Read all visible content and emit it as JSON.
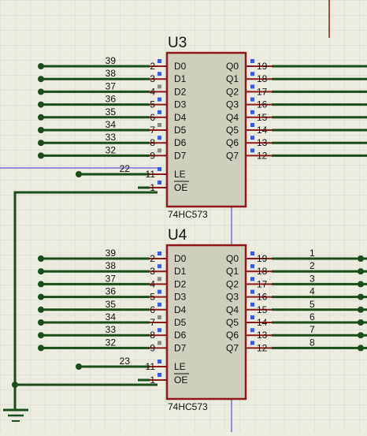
{
  "colors": {
    "background": "#ebebe0",
    "grid": "#d6d6cc",
    "wire": "#1b4d1b",
    "pin": "#8b1a1a",
    "chip_fill": "#cfcfbe",
    "marker_blue": "#3b5bdb",
    "marker_gray": "#8a8a8a",
    "bus_line": "#3a3acc"
  },
  "chips": [
    {
      "ref": "U3",
      "part": "74HC573",
      "inputs": [
        {
          "name": "D0",
          "pin": "2",
          "net": "39",
          "marker": "blue"
        },
        {
          "name": "D1",
          "pin": "3",
          "net": "38",
          "marker": "blue"
        },
        {
          "name": "D2",
          "pin": "4",
          "net": "37",
          "marker": "gray"
        },
        {
          "name": "D3",
          "pin": "5",
          "net": "36",
          "marker": "blue"
        },
        {
          "name": "D4",
          "pin": "6",
          "net": "35",
          "marker": "blue"
        },
        {
          "name": "D5",
          "pin": "7",
          "net": "34",
          "marker": "gray"
        },
        {
          "name": "D6",
          "pin": "8",
          "net": "33",
          "marker": "blue"
        },
        {
          "name": "D7",
          "pin": "9",
          "net": "32",
          "marker": "gray"
        }
      ],
      "outputs": [
        {
          "name": "Q0",
          "pin": "19",
          "net": "",
          "marker": "blue"
        },
        {
          "name": "Q1",
          "pin": "18",
          "net": "",
          "marker": "blue"
        },
        {
          "name": "Q2",
          "pin": "17",
          "net": "",
          "marker": "blue"
        },
        {
          "name": "Q3",
          "pin": "16",
          "net": "",
          "marker": "blue"
        },
        {
          "name": "Q4",
          "pin": "15",
          "net": "",
          "marker": "blue"
        },
        {
          "name": "Q5",
          "pin": "14",
          "net": "",
          "marker": "blue"
        },
        {
          "name": "Q6",
          "pin": "13",
          "net": "",
          "marker": "blue"
        },
        {
          "name": "Q7",
          "pin": "12",
          "net": "",
          "marker": "blue"
        }
      ],
      "controls": [
        {
          "name": "LE",
          "pin": "11",
          "net": "22",
          "overline": false,
          "marker": "blue"
        },
        {
          "name": "OE",
          "pin": "1",
          "net": "",
          "overline": true,
          "marker": "blue"
        }
      ]
    },
    {
      "ref": "U4",
      "part": "74HC573",
      "inputs": [
        {
          "name": "D0",
          "pin": "2",
          "net": "39",
          "marker": "blue"
        },
        {
          "name": "D1",
          "pin": "3",
          "net": "38",
          "marker": "blue"
        },
        {
          "name": "D2",
          "pin": "4",
          "net": "37",
          "marker": "gray"
        },
        {
          "name": "D3",
          "pin": "5",
          "net": "36",
          "marker": "blue"
        },
        {
          "name": "D4",
          "pin": "6",
          "net": "35",
          "marker": "blue"
        },
        {
          "name": "D5",
          "pin": "7",
          "net": "34",
          "marker": "gray"
        },
        {
          "name": "D6",
          "pin": "8",
          "net": "33",
          "marker": "blue"
        },
        {
          "name": "D7",
          "pin": "9",
          "net": "32",
          "marker": "gray"
        }
      ],
      "outputs": [
        {
          "name": "Q0",
          "pin": "19",
          "net": "1",
          "marker": "blue"
        },
        {
          "name": "Q1",
          "pin": "18",
          "net": "2",
          "marker": "blue"
        },
        {
          "name": "Q2",
          "pin": "17",
          "net": "3",
          "marker": "blue"
        },
        {
          "name": "Q3",
          "pin": "16",
          "net": "4",
          "marker": "blue"
        },
        {
          "name": "Q4",
          "pin": "15",
          "net": "5",
          "marker": "blue"
        },
        {
          "name": "Q5",
          "pin": "14",
          "net": "6",
          "marker": "blue"
        },
        {
          "name": "Q6",
          "pin": "13",
          "net": "7",
          "marker": "blue"
        },
        {
          "name": "Q7",
          "pin": "12",
          "net": "8",
          "marker": "blue"
        }
      ],
      "controls": [
        {
          "name": "LE",
          "pin": "11",
          "net": "23",
          "overline": false,
          "marker": "blue"
        },
        {
          "name": "OE",
          "pin": "1",
          "net": "",
          "overline": true,
          "marker": "blue"
        }
      ]
    }
  ]
}
